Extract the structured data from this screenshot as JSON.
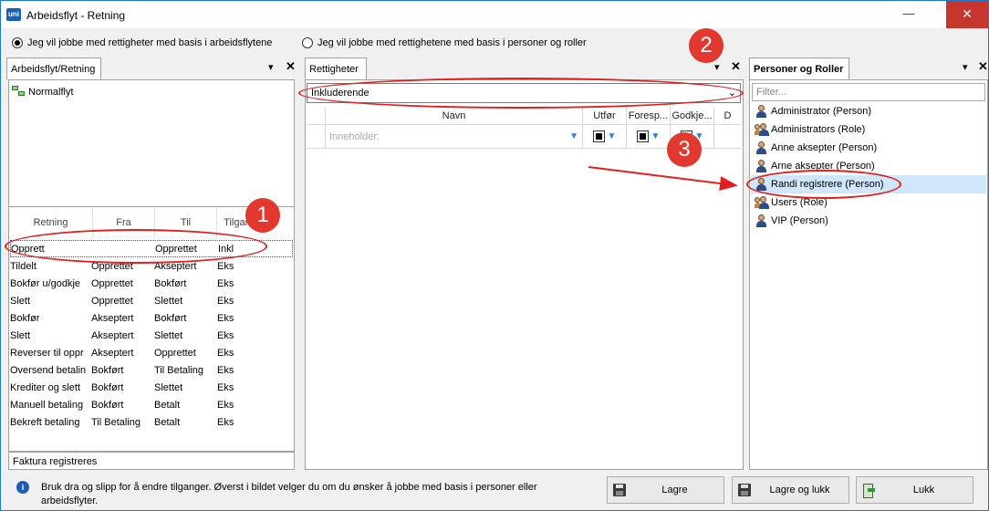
{
  "window": {
    "title": "Arbeidsflyt - Retning",
    "app_icon_text": "uni",
    "minimize_label": "—",
    "close_label": "✕"
  },
  "mode": {
    "option1": "Jeg vil jobbe med rettigheter med basis i arbeidsflytene",
    "option2": "Jeg vil jobbe med rettighetene med basis i personer og roller",
    "selected": "option1"
  },
  "left_panel": {
    "tab": "Arbeidsflyt/Retning",
    "pin": "▾",
    "close": "✕",
    "tree": [
      "Normalflyt"
    ],
    "columns": [
      "Retning",
      "Fra",
      "Til",
      "Tilgang"
    ],
    "rows": [
      [
        "Opprett",
        "",
        "Opprettet",
        "Inkl"
      ],
      [
        "Tildelt",
        "Opprettet",
        "Akseptert",
        "Eks"
      ],
      [
        "Bokfør u/godkje",
        "Opprettet",
        "Bokført",
        "Eks"
      ],
      [
        "Slett",
        "Opprettet",
        "Slettet",
        "Eks"
      ],
      [
        "Bokfør",
        "Akseptert",
        "Bokført",
        "Eks"
      ],
      [
        "Slett",
        "Akseptert",
        "Slettet",
        "Eks"
      ],
      [
        "Reverser til oppr",
        "Akseptert",
        "Opprettet",
        "Eks"
      ],
      [
        "Oversend betalin",
        "Bokført",
        "Til Betaling",
        "Eks"
      ],
      [
        "Krediter og slett",
        "Bokført",
        "Slettet",
        "Eks"
      ],
      [
        "Manuell betaling",
        "Bokført",
        "Betalt",
        "Eks"
      ],
      [
        "Bekreft betaling",
        "Til Betaling",
        "Betalt",
        "Eks"
      ]
    ],
    "footer": "Faktura registreres"
  },
  "middle_panel": {
    "tab": "Rettigheter",
    "pin": "▾",
    "close": "✕",
    "dropdown_value": "Inkluderende",
    "dropdown_arrow": "⌄",
    "columns": [
      "Navn",
      "Utfør",
      "Foresp...",
      "Godkje...",
      "D"
    ],
    "filter_placeholder": "Inneholder:",
    "funnel": "▼"
  },
  "right_panel": {
    "tab": "Personer og Roller",
    "pin": "▾",
    "close": "✕",
    "filter_placeholder": "Filter...",
    "items": [
      {
        "label": "Administrator (Person)",
        "kind": "person"
      },
      {
        "label": "Administrators (Role)",
        "kind": "role"
      },
      {
        "label": "Anne aksepter (Person)",
        "kind": "person"
      },
      {
        "label": "Arne aksepter (Person)",
        "kind": "person"
      },
      {
        "label": "Randi registrere (Person)",
        "kind": "person",
        "selected": true
      },
      {
        "label": "Users (Role)",
        "kind": "role"
      },
      {
        "label": "VIP (Person)",
        "kind": "person"
      }
    ]
  },
  "footer": {
    "info_icon": "i",
    "info_text": "Bruk dra og slipp for å endre tilganger. Øverst i bildet velger du om du ønsker å jobbe med basis i personer eller arbeidsflyter.",
    "save_label": "Lagre",
    "save_close_label": "Lagre og lukk",
    "close_label": "Lukk"
  },
  "annotations": {
    "marker1": "1",
    "marker2": "2",
    "marker3": "3",
    "color": "#e3382f"
  }
}
